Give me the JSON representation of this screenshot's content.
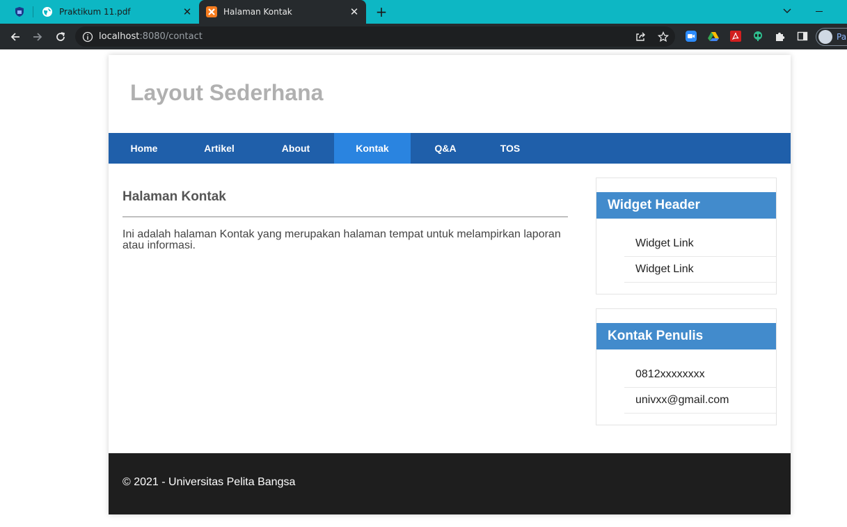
{
  "browser": {
    "tabs": [
      {
        "title": "Praktikum 11.pdf",
        "close": "✕"
      },
      {
        "title": "Halaman Kontak",
        "close": "✕"
      }
    ],
    "new_tab": "+",
    "address": {
      "host": "localhost",
      "path": ":8080/contact"
    },
    "profile_label": "Pa",
    "icons": {
      "pinned_tab": "shield-emblem-icon",
      "tab1_favicon": "globe-icon",
      "tab2_favicon": "xampp-icon",
      "back": "arrow-left-icon",
      "forward": "arrow-right-icon",
      "reload": "reload-icon",
      "site_info": "info-icon",
      "share": "share-icon",
      "bookmark": "star-icon",
      "extensions": [
        "zoom-icon",
        "google-drive-icon",
        "acrobat-icon",
        "alien-icon",
        "puzzle-icon"
      ],
      "side_panel": "side-panel-icon"
    },
    "colors": {
      "tab_strip": "#0db7c4",
      "toolbar": "#262a2d"
    }
  },
  "site": {
    "title": "Layout Sederhana",
    "nav": [
      {
        "label": "Home",
        "active": false
      },
      {
        "label": "Artikel",
        "active": false
      },
      {
        "label": "About",
        "active": false
      },
      {
        "label": "Kontak",
        "active": true
      },
      {
        "label": "Q&A",
        "active": false
      },
      {
        "label": "TOS",
        "active": false
      }
    ],
    "content": {
      "heading": "Halaman Kontak",
      "body": "Ini adalah halaman Kontak yang merupakan halaman tempat untuk melampirkan laporan atau informasi."
    },
    "widgets": [
      {
        "header": "Widget Header",
        "links": [
          "Widget Link",
          "Widget Link"
        ]
      },
      {
        "header": "Kontak Penulis",
        "links": [
          "0812xxxxxxxx",
          "univxx@gmail.com"
        ]
      }
    ],
    "footer": "© 2021 - Universitas Pelita Bangsa",
    "colors": {
      "nav": "#1f5faa",
      "nav_active": "#2a84e0",
      "widget_header": "#428bcc",
      "footer": "#1e1e1e"
    }
  }
}
